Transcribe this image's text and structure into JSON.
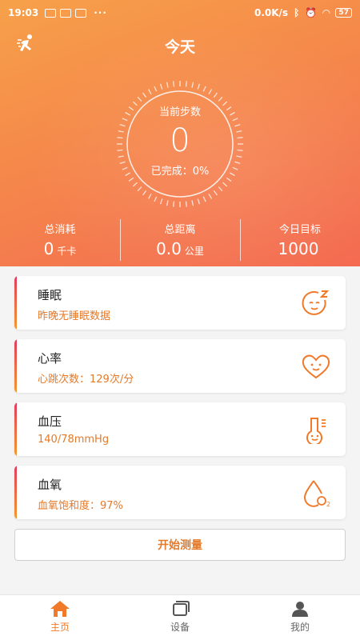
{
  "statusbar": {
    "time": "19:03",
    "speed": "0.0K/s",
    "battery": "57"
  },
  "header": {
    "title": "今天"
  },
  "steps": {
    "label": "当前步数",
    "value": "0",
    "completed_label": "已完成",
    "completed_sep": "：",
    "completed_value": "0%"
  },
  "stats": [
    {
      "label": "总消耗",
      "value": "0",
      "unit": "千卡"
    },
    {
      "label": "总距离",
      "value": "0.0",
      "unit": "公里"
    },
    {
      "label": "今日目标",
      "value": "1000",
      "unit": ""
    }
  ],
  "cards": [
    {
      "title": "睡眠",
      "subtitle": "昨晚无睡眠数据",
      "icon": "sleep-face-icon"
    },
    {
      "title": "心率",
      "subtitle": "心跳次数：129次/分",
      "icon": "heart-face-icon"
    },
    {
      "title": "血压",
      "subtitle": "140/78mmHg",
      "icon": "thermometer-face-icon"
    },
    {
      "title": "血氧",
      "subtitle": "血氧饱和度：97%",
      "icon": "o2-drop-icon"
    }
  ],
  "measure_button": "开始测量",
  "tabs": [
    {
      "label": "主页",
      "icon": "home-icon",
      "active": true
    },
    {
      "label": "设备",
      "icon": "device-icon",
      "active": false
    },
    {
      "label": "我的",
      "icon": "profile-icon",
      "active": false
    }
  ],
  "colors": {
    "accent": "#f07a2a",
    "hero_start": "#f7a14a",
    "hero_end": "#f46a52",
    "card_bar_top": "#e23a5e",
    "card_bar_bottom": "#f29a2e"
  }
}
